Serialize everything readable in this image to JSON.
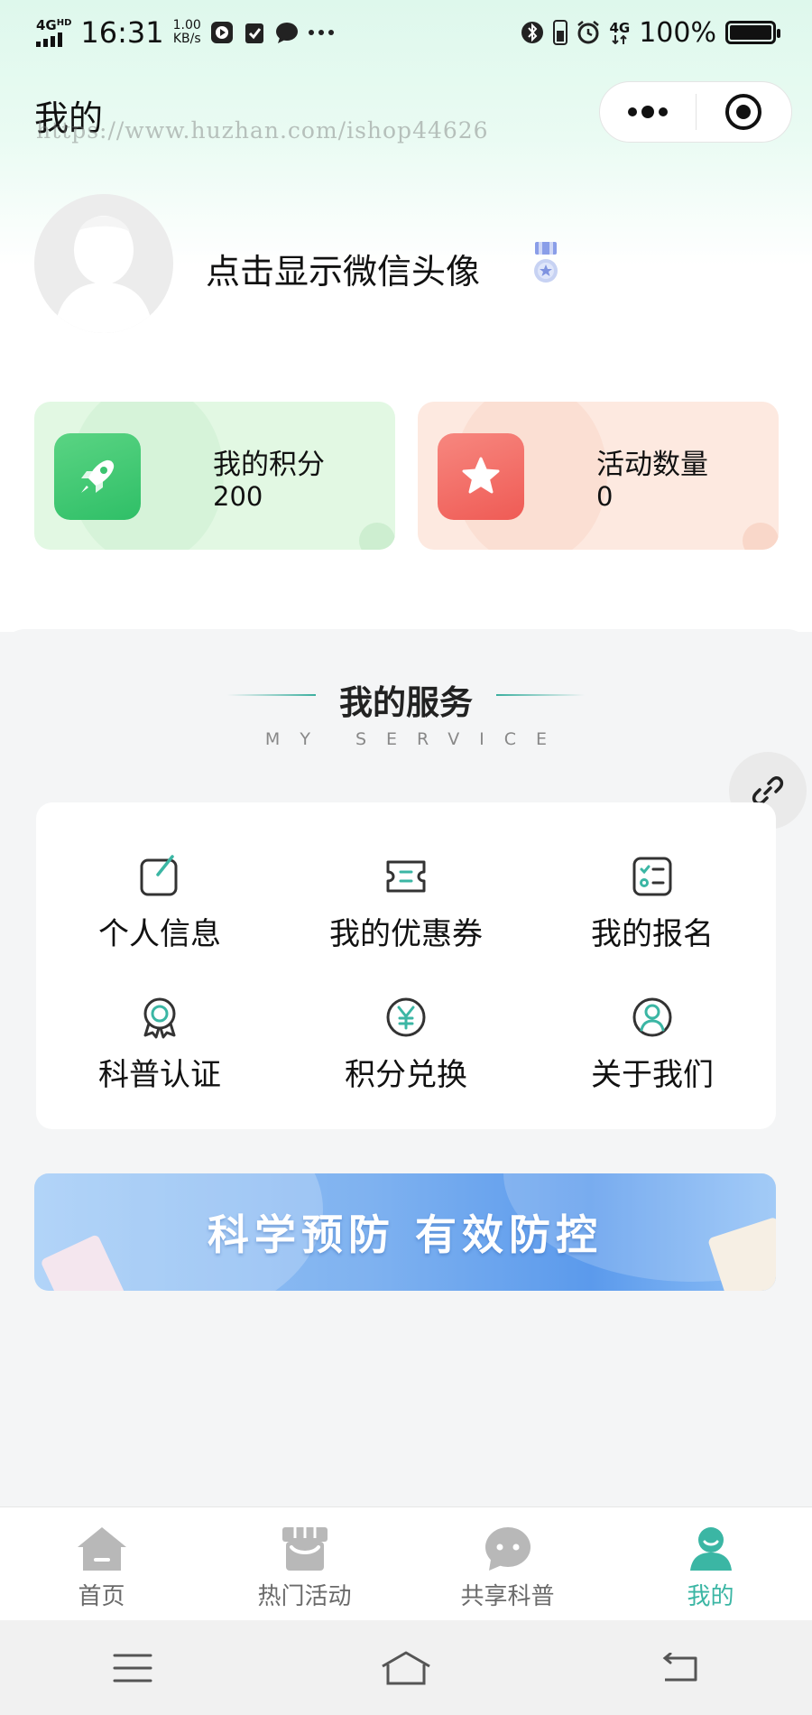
{
  "status_bar": {
    "network": "4G",
    "network_sup": "HD",
    "time": "16:31",
    "speed_value": "1.00",
    "speed_unit": "KB/s",
    "network_right": "4G",
    "battery": "100%"
  },
  "header": {
    "title": "我的",
    "watermark": "https://www.huzhan.com/ishop44626"
  },
  "profile": {
    "nickname": "点击显示微信头像"
  },
  "stats": {
    "points_label": "我的积分",
    "points_value": "200",
    "activities_label": "活动数量",
    "activities_value": "0"
  },
  "services": {
    "title": "我的服务",
    "subtitle": "MY SERVICE",
    "items": [
      {
        "label": "个人信息",
        "icon": "edit-icon"
      },
      {
        "label": "我的优惠券",
        "icon": "coupon-icon"
      },
      {
        "label": "我的报名",
        "icon": "checklist-icon"
      },
      {
        "label": "科普认证",
        "icon": "award-icon"
      },
      {
        "label": "积分兑换",
        "icon": "yen-coin-icon"
      },
      {
        "label": "关于我们",
        "icon": "user-circle-icon"
      }
    ]
  },
  "banner": {
    "text": "科学预防 有效防控"
  },
  "tabs": [
    {
      "label": "首页",
      "icon": "home-icon",
      "active": false
    },
    {
      "label": "热门活动",
      "icon": "shop-icon",
      "active": false
    },
    {
      "label": "共享科普",
      "icon": "chat-icon",
      "active": false
    },
    {
      "label": "我的",
      "icon": "profile-icon",
      "active": true
    }
  ],
  "colors": {
    "accent": "#3bb6a4",
    "points_card": "#e2f8e3",
    "activities_card": "#fde9e0",
    "banner": "#7fb2f0"
  }
}
